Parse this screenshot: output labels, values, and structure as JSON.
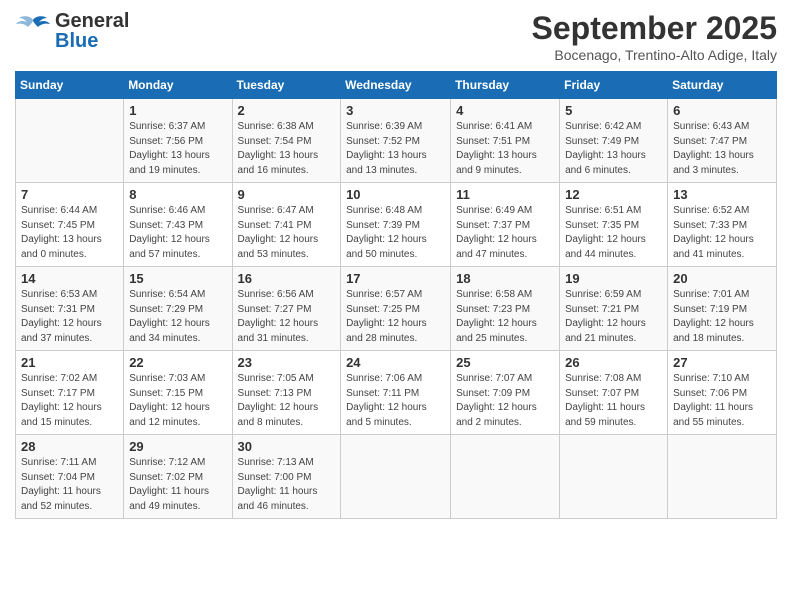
{
  "header": {
    "logo_general": "General",
    "logo_blue": "Blue",
    "month_title": "September 2025",
    "location": "Bocenago, Trentino-Alto Adige, Italy"
  },
  "days_of_week": [
    "Sunday",
    "Monday",
    "Tuesday",
    "Wednesday",
    "Thursday",
    "Friday",
    "Saturday"
  ],
  "weeks": [
    [
      {
        "day": "",
        "info": ""
      },
      {
        "day": "1",
        "info": "Sunrise: 6:37 AM\nSunset: 7:56 PM\nDaylight: 13 hours\nand 19 minutes."
      },
      {
        "day": "2",
        "info": "Sunrise: 6:38 AM\nSunset: 7:54 PM\nDaylight: 13 hours\nand 16 minutes."
      },
      {
        "day": "3",
        "info": "Sunrise: 6:39 AM\nSunset: 7:52 PM\nDaylight: 13 hours\nand 13 minutes."
      },
      {
        "day": "4",
        "info": "Sunrise: 6:41 AM\nSunset: 7:51 PM\nDaylight: 13 hours\nand 9 minutes."
      },
      {
        "day": "5",
        "info": "Sunrise: 6:42 AM\nSunset: 7:49 PM\nDaylight: 13 hours\nand 6 minutes."
      },
      {
        "day": "6",
        "info": "Sunrise: 6:43 AM\nSunset: 7:47 PM\nDaylight: 13 hours\nand 3 minutes."
      }
    ],
    [
      {
        "day": "7",
        "info": "Sunrise: 6:44 AM\nSunset: 7:45 PM\nDaylight: 13 hours\nand 0 minutes."
      },
      {
        "day": "8",
        "info": "Sunrise: 6:46 AM\nSunset: 7:43 PM\nDaylight: 12 hours\nand 57 minutes."
      },
      {
        "day": "9",
        "info": "Sunrise: 6:47 AM\nSunset: 7:41 PM\nDaylight: 12 hours\nand 53 minutes."
      },
      {
        "day": "10",
        "info": "Sunrise: 6:48 AM\nSunset: 7:39 PM\nDaylight: 12 hours\nand 50 minutes."
      },
      {
        "day": "11",
        "info": "Sunrise: 6:49 AM\nSunset: 7:37 PM\nDaylight: 12 hours\nand 47 minutes."
      },
      {
        "day": "12",
        "info": "Sunrise: 6:51 AM\nSunset: 7:35 PM\nDaylight: 12 hours\nand 44 minutes."
      },
      {
        "day": "13",
        "info": "Sunrise: 6:52 AM\nSunset: 7:33 PM\nDaylight: 12 hours\nand 41 minutes."
      }
    ],
    [
      {
        "day": "14",
        "info": "Sunrise: 6:53 AM\nSunset: 7:31 PM\nDaylight: 12 hours\nand 37 minutes."
      },
      {
        "day": "15",
        "info": "Sunrise: 6:54 AM\nSunset: 7:29 PM\nDaylight: 12 hours\nand 34 minutes."
      },
      {
        "day": "16",
        "info": "Sunrise: 6:56 AM\nSunset: 7:27 PM\nDaylight: 12 hours\nand 31 minutes."
      },
      {
        "day": "17",
        "info": "Sunrise: 6:57 AM\nSunset: 7:25 PM\nDaylight: 12 hours\nand 28 minutes."
      },
      {
        "day": "18",
        "info": "Sunrise: 6:58 AM\nSunset: 7:23 PM\nDaylight: 12 hours\nand 25 minutes."
      },
      {
        "day": "19",
        "info": "Sunrise: 6:59 AM\nSunset: 7:21 PM\nDaylight: 12 hours\nand 21 minutes."
      },
      {
        "day": "20",
        "info": "Sunrise: 7:01 AM\nSunset: 7:19 PM\nDaylight: 12 hours\nand 18 minutes."
      }
    ],
    [
      {
        "day": "21",
        "info": "Sunrise: 7:02 AM\nSunset: 7:17 PM\nDaylight: 12 hours\nand 15 minutes."
      },
      {
        "day": "22",
        "info": "Sunrise: 7:03 AM\nSunset: 7:15 PM\nDaylight: 12 hours\nand 12 minutes."
      },
      {
        "day": "23",
        "info": "Sunrise: 7:05 AM\nSunset: 7:13 PM\nDaylight: 12 hours\nand 8 minutes."
      },
      {
        "day": "24",
        "info": "Sunrise: 7:06 AM\nSunset: 7:11 PM\nDaylight: 12 hours\nand 5 minutes."
      },
      {
        "day": "25",
        "info": "Sunrise: 7:07 AM\nSunset: 7:09 PM\nDaylight: 12 hours\nand 2 minutes."
      },
      {
        "day": "26",
        "info": "Sunrise: 7:08 AM\nSunset: 7:07 PM\nDaylight: 11 hours\nand 59 minutes."
      },
      {
        "day": "27",
        "info": "Sunrise: 7:10 AM\nSunset: 7:06 PM\nDaylight: 11 hours\nand 55 minutes."
      }
    ],
    [
      {
        "day": "28",
        "info": "Sunrise: 7:11 AM\nSunset: 7:04 PM\nDaylight: 11 hours\nand 52 minutes."
      },
      {
        "day": "29",
        "info": "Sunrise: 7:12 AM\nSunset: 7:02 PM\nDaylight: 11 hours\nand 49 minutes."
      },
      {
        "day": "30",
        "info": "Sunrise: 7:13 AM\nSunset: 7:00 PM\nDaylight: 11 hours\nand 46 minutes."
      },
      {
        "day": "",
        "info": ""
      },
      {
        "day": "",
        "info": ""
      },
      {
        "day": "",
        "info": ""
      },
      {
        "day": "",
        "info": ""
      }
    ]
  ]
}
